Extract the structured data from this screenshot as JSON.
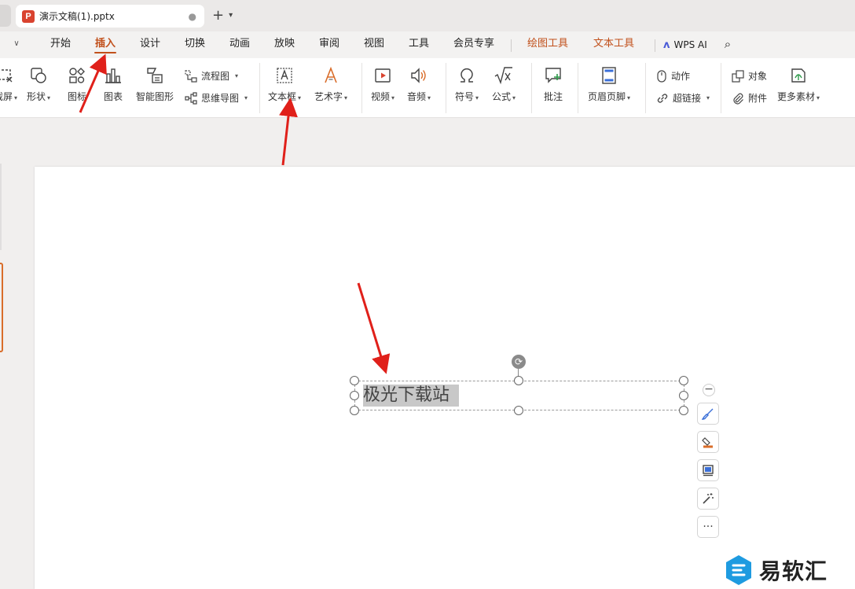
{
  "tab": {
    "title": "演示文稿(1).pptx",
    "app_badge": "P"
  },
  "menu": {
    "items": [
      "开始",
      "插入",
      "设计",
      "切换",
      "动画",
      "放映",
      "审阅",
      "视图",
      "工具",
      "会员专享"
    ],
    "tool_items": [
      "绘图工具",
      "文本工具"
    ],
    "ai_label": "WPS AI",
    "active": "插入"
  },
  "ribbon": {
    "cut_label": "截屏",
    "shape_label": "形状",
    "icon_label": "图标",
    "chart_label": "图表",
    "smartart_label": "智能图形",
    "flowchart_label": "流程图",
    "mindmap_label": "思维导图",
    "textbox_label": "文本框",
    "wordart_label": "艺术字",
    "video_label": "视频",
    "audio_label": "音频",
    "symbol_label": "符号",
    "formula_label": "公式",
    "comment_label": "批注",
    "headerfooter_label": "页眉页脚",
    "action_label": "动作",
    "hyperlink_label": "超链接",
    "object_label": "对象",
    "attachment_label": "附件",
    "more_label": "更多素材"
  },
  "slide": {
    "textbox_text": "极光下载站"
  },
  "watermark": {
    "text": "易软汇"
  },
  "colors": {
    "accent": "#c1501b",
    "arrow": "#e0201a"
  }
}
